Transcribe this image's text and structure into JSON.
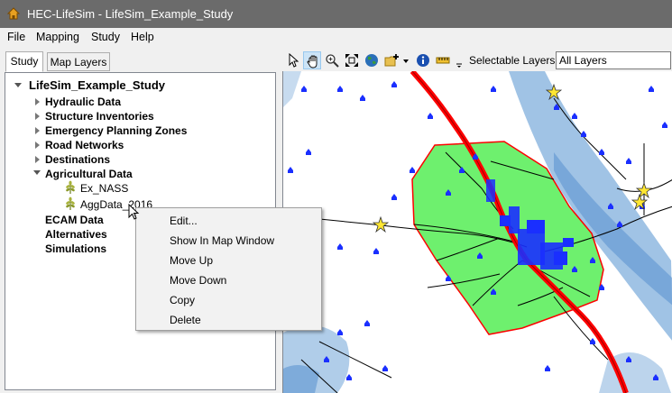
{
  "window": {
    "title": "HEC-LifeSim - LifeSim_Example_Study"
  },
  "menu": [
    "File",
    "Mapping",
    "Study",
    "Help"
  ],
  "tabs": [
    "Study",
    "Map Layers"
  ],
  "tree": {
    "root": "LifeSim_Example_Study",
    "items": [
      "Hydraulic Data",
      "Structure Inventories",
      "Emergency Planning Zones",
      "Road Networks",
      "Destinations",
      "Agricultural Data"
    ],
    "ag_children": [
      "Ex_NASS",
      "AggData_2016"
    ],
    "other_items": [
      "ECAM Data",
      "Alternatives",
      "Simulations"
    ]
  },
  "toolbar": {
    "selectable_label": "Selectable Layers:",
    "selectable_value": "All Layers",
    "icons": [
      "select-arrow-icon",
      "pan-hand-icon",
      "zoom-in-icon",
      "full-extent-icon",
      "globe-icon",
      "add-layer-icon",
      "dropdown-arrow-icon",
      "info-icon",
      "measure-ruler-icon"
    ]
  },
  "context_menu": [
    "Edit...",
    "Show In Map Window",
    "Move Up",
    "Move Down",
    "Copy",
    "Delete"
  ],
  "colors": {
    "titlebar": "#6b6b6b",
    "polygon_fill": "#6ef06e",
    "polygon_border": "#ff0000",
    "structures": "#1a2fff",
    "flood": "#8fb8e0",
    "road": "#ff0000",
    "star": "#ffe733"
  }
}
